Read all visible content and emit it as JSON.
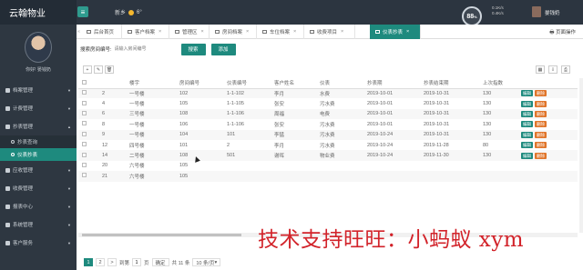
{
  "app": {
    "title": "云翰物业",
    "menu_icon": "≡"
  },
  "header": {
    "weather_city": "新乡",
    "weather_temp": "6°",
    "gauge_value": "88",
    "gauge_unit": "%",
    "net_up": "0.1K/s",
    "net_down": "0.4K/s",
    "user_name": "晏钱奶"
  },
  "sidebar": {
    "welcome": "你好!  晏钱奶",
    "items": [
      {
        "label": "档案管理",
        "type": "group"
      },
      {
        "label": "计费管理",
        "type": "group"
      },
      {
        "label": "抄表管理",
        "type": "group-open"
      },
      {
        "label": "抄表查询",
        "type": "sub"
      },
      {
        "label": "仪表抄表",
        "type": "sub-active"
      },
      {
        "label": "应收管理",
        "type": "group"
      },
      {
        "label": "收费管理",
        "type": "group"
      },
      {
        "label": "报表中心",
        "type": "group"
      },
      {
        "label": "系统管理",
        "type": "group"
      },
      {
        "label": "客户服务",
        "type": "group"
      }
    ]
  },
  "tabs": [
    {
      "label": "后台首页",
      "closable": false,
      "active": false
    },
    {
      "label": "客户档案",
      "closable": true,
      "active": false
    },
    {
      "label": "管理区",
      "closable": true,
      "active": false
    },
    {
      "label": "房间档案",
      "closable": true,
      "active": false
    },
    {
      "label": "车位档案",
      "closable": true,
      "active": false
    },
    {
      "label": "收费项目",
      "closable": true,
      "active": false
    },
    {
      "label": "仪表抄表",
      "closable": true,
      "active": true
    }
  ],
  "tab_ops_label": "页面操作",
  "search": {
    "label": "搜索房间编号:",
    "placeholder": "请输入房间编号",
    "search_button": "搜索",
    "add_button": "添加"
  },
  "table": {
    "columns": [
      "",
      "",
      "楼宇",
      "房间编号",
      "仪表编号",
      "客户姓名",
      "仪表",
      "抄表期",
      "抄表结束期",
      "上次指数"
    ],
    "rows": [
      [
        "2",
        "一号楼",
        "102",
        "1-1-102",
        "李月",
        "水费",
        "2019-10-01",
        "2019-10-31",
        "130"
      ],
      [
        "4",
        "一号楼",
        "105",
        "1-1-105",
        "张安",
        "污水费",
        "2019-10-01",
        "2019-10-31",
        "130"
      ],
      [
        "6",
        "三号楼",
        "108",
        "1-1-106",
        "周福",
        "电费",
        "2019-10-01",
        "2019-10-31",
        "130"
      ],
      [
        "8",
        "一号楼",
        "106",
        "1-1-106",
        "张安",
        "污水费",
        "2019-10-01",
        "2019-10-31",
        "130"
      ],
      [
        "9",
        "一号楼",
        "104",
        "101",
        "李猛",
        "污水费",
        "2019-10-24",
        "2019-10-31",
        "130"
      ],
      [
        "12",
        "四号楼",
        "101",
        "2",
        "李月",
        "污水费",
        "2019-10-24",
        "2019-11-28",
        "80"
      ],
      [
        "14",
        "二号楼",
        "108",
        "501",
        "谢晖",
        "物业费",
        "2019-10-24",
        "2019-11-30",
        "130"
      ],
      [
        "20",
        "六号楼",
        "105",
        "",
        "",
        "",
        "",
        "",
        ""
      ],
      [
        "21",
        "六号楼",
        "105",
        "",
        "",
        "",
        "",
        "",
        ""
      ]
    ],
    "op_edit": "编辑",
    "op_delete": "删除"
  },
  "pager": {
    "current": "1",
    "next": "2",
    "next_arrow": ">",
    "goto_label": "到第",
    "goto_value": "1",
    "page_unit": "页",
    "go_button": "确定",
    "total": "共 11 条",
    "page_size": "10 条/页"
  },
  "watermark": "技术支持旺旺：小蚂蚁 xym"
}
